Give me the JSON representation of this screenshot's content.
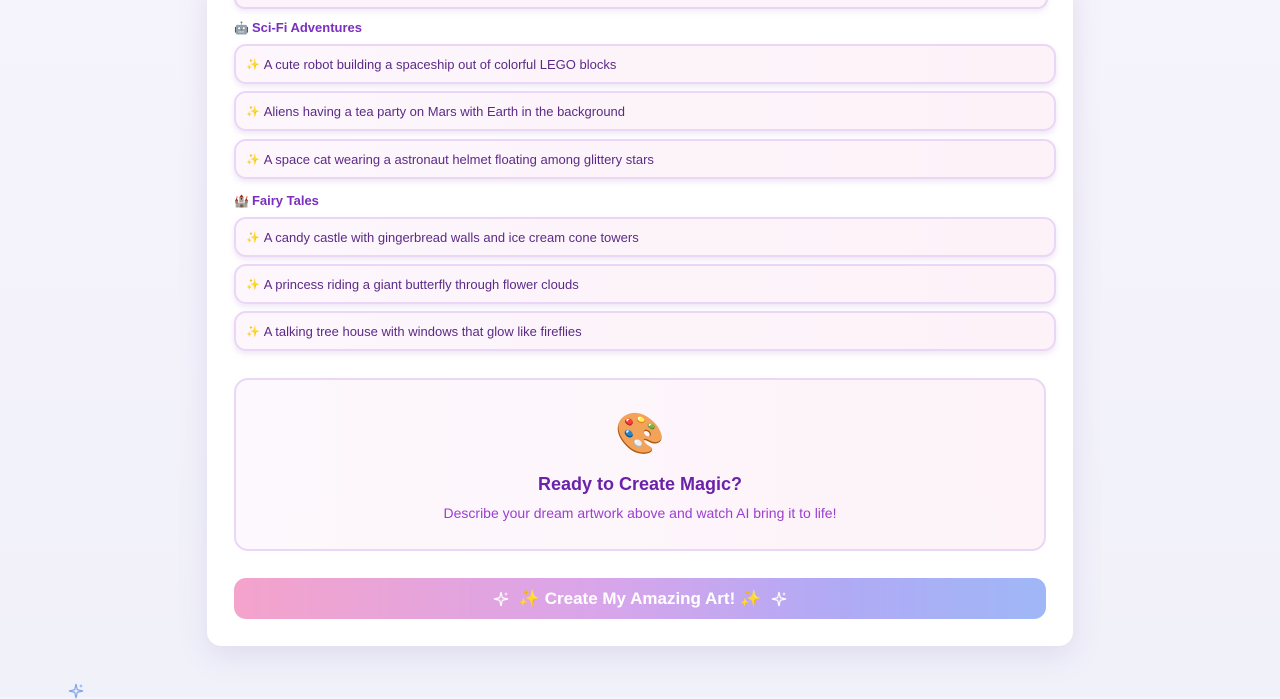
{
  "categories": [
    {
      "emoji": "🤖",
      "title": "Sci-Fi Adventures",
      "prompts": [
        "A cute robot building a spaceship out of colorful LEGO blocks",
        "Aliens having a tea party on Mars with Earth in the background",
        "A space cat wearing a astronaut helmet floating among glittery stars"
      ]
    },
    {
      "emoji": "🏰",
      "title": "Fairy Tales",
      "prompts": [
        "A candy castle with gingerbread walls and ice cream cone towers",
        "A princess riding a giant butterfly through flower clouds",
        "A talking tree house with windows that glow like fireflies"
      ]
    }
  ],
  "prompt_bullet": "✨",
  "ready": {
    "emoji": "🎨",
    "title": "Ready to Create Magic?",
    "subtitle": "Describe your dream artwork above and watch AI bring it to life!"
  },
  "create_button": {
    "label": "✨ Create My Amazing Art! ✨",
    "icon": "sparkles-icon"
  },
  "colors": {
    "accent": "#7b2fbe",
    "title": "#6b21a8",
    "button_start": "#f4a3cb",
    "button_end": "#9fb7f7"
  }
}
